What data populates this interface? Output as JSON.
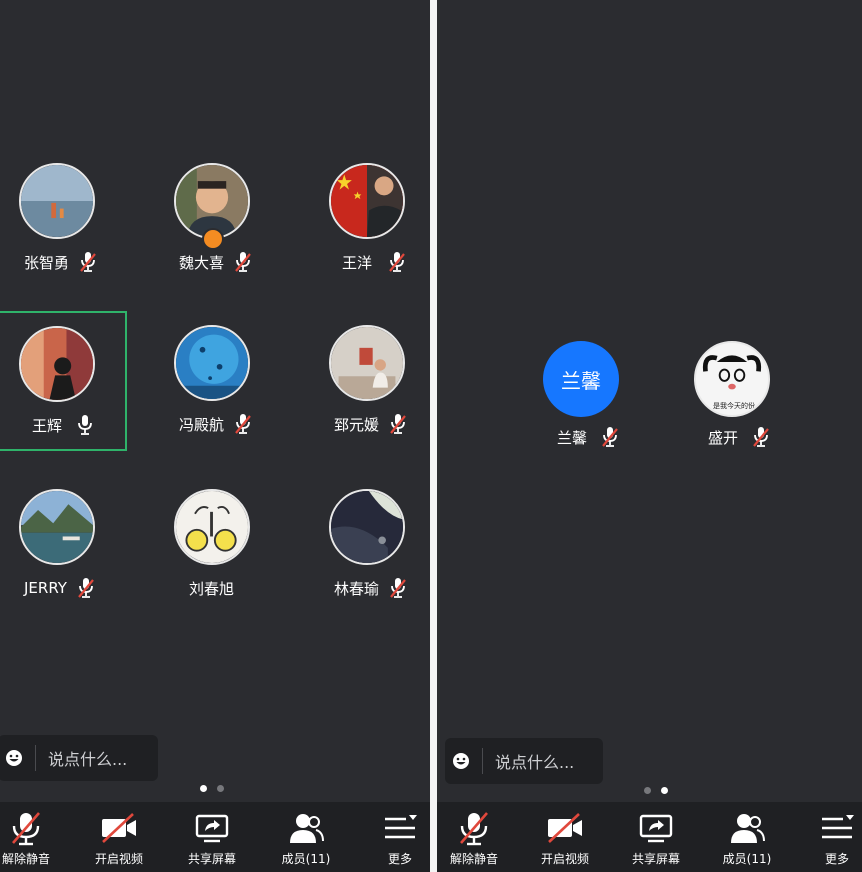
{
  "left_page": {
    "participants": [
      {
        "name": "张智勇",
        "mic": "muted"
      },
      {
        "name": "魏大喜",
        "mic": "muted",
        "host": true
      },
      {
        "name": "王洋",
        "mic": "muted"
      },
      {
        "name": "王辉",
        "mic": "on",
        "speaking": true
      },
      {
        "name": "冯殿航",
        "mic": "muted"
      },
      {
        "name": "郅元媛",
        "mic": "muted"
      },
      {
        "name": "JERRY",
        "mic": "muted"
      },
      {
        "name": "刘春旭",
        "mic": "none"
      },
      {
        "name": "林春瑜",
        "mic": "muted"
      }
    ],
    "chat_placeholder": "说点什么...",
    "page_indicator": {
      "total": 2,
      "active": 1
    }
  },
  "right_page": {
    "participants": [
      {
        "name": "兰馨",
        "avatar_text": "兰馨",
        "mic": "muted"
      },
      {
        "name": "盛开",
        "mic": "muted",
        "avatar_caption": "是我今天的份"
      }
    ],
    "chat_placeholder": "说点什么...",
    "page_indicator": {
      "total": 2,
      "active": 2
    }
  },
  "toolbar": {
    "unmute": "解除静音",
    "start_video": "开启视频",
    "share_screen": "共享屏幕",
    "members": "成员(11)",
    "more": "更多"
  },
  "colors": {
    "background": "#2b2c30",
    "toolbar": "#1f2023",
    "active_border": "#2fb36a",
    "muted_red": "#e0483c",
    "avatar_blue": "#1677ff",
    "host_badge": "#f48c22"
  }
}
